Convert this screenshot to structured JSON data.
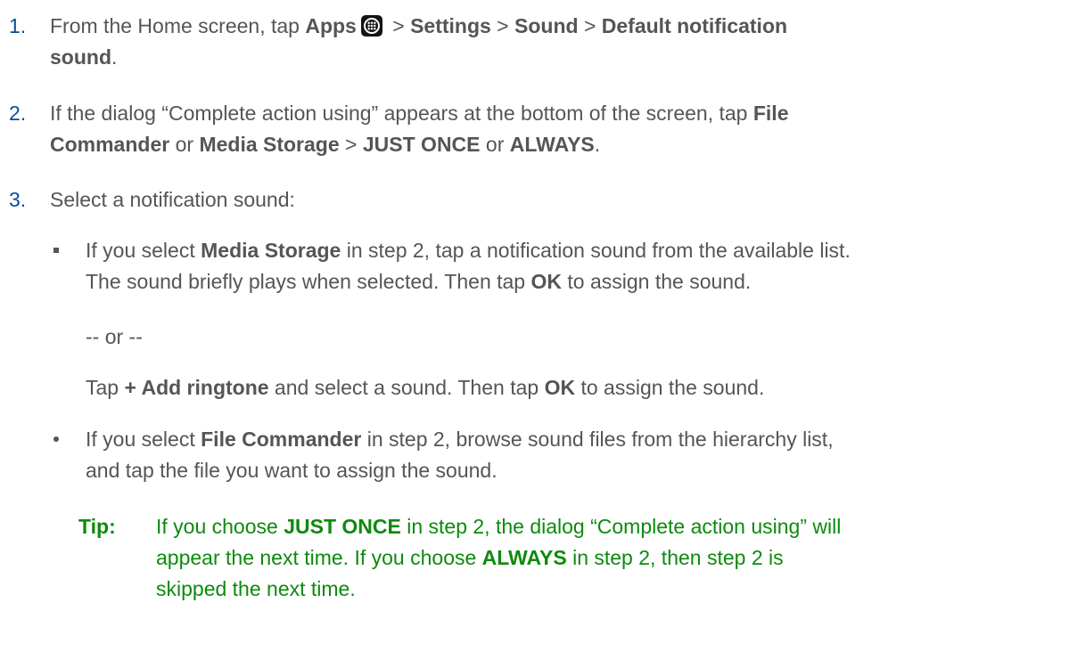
{
  "step1": {
    "num": "1.",
    "t1": "From the Home screen, tap ",
    "apps": "Apps",
    "icon": "apps-grid-icon",
    "sep1": " > ",
    "settings": "Settings",
    "sep2": " > ",
    "sound": "Sound",
    "sep3": " > ",
    "default_notif": "Default notification",
    "sound2": "sound",
    "end": "."
  },
  "step2": {
    "num": "2.",
    "t1": "If the dialog “Complete action using” appears at the bottom of the screen, tap ",
    "file": "File",
    "commander": "Commander",
    "or1": " or ",
    "media": "Media Storage",
    "sep": " > ",
    "just_once": "JUST ONCE",
    "or2": " or ",
    "always": "ALWAYS",
    "end": "."
  },
  "step3": {
    "num": "3.",
    "text": "Select a notification sound:"
  },
  "bullet1": {
    "t1": "If you select ",
    "media": "Media Storage",
    "t2": " in step 2, tap a notification sound from the available list.",
    "l2a": "The sound briefly plays when selected. Then tap ",
    "ok": "OK",
    "l2b": " to assign the sound."
  },
  "or_separator": "-- or --",
  "alt": {
    "t1": "Tap ",
    "add": "+ Add ringtone",
    "t2": " and select a sound. Then tap ",
    "ok": "OK",
    "t3": " to assign the sound."
  },
  "bullet2": {
    "t1": "If you select ",
    "file_commander": "File Commander",
    "t2": " in step 2, browse sound files from the hierarchy list,",
    "l2": "and tap the file you want to assign the sound."
  },
  "tip": {
    "label": "Tip:",
    "t1": "If you choose ",
    "just_once": "JUST ONCE",
    "t2": " in step 2, the dialog “Complete action using” will",
    "l2a": "appear the next time. If you choose ",
    "always": "ALWAYS",
    "l2b": " in step 2, then step 2 is",
    "l3": "skipped the next time."
  },
  "colors": {
    "body_text": "#555555",
    "step_number": "#0b4a9a",
    "tip": "#0d8a0d"
  }
}
